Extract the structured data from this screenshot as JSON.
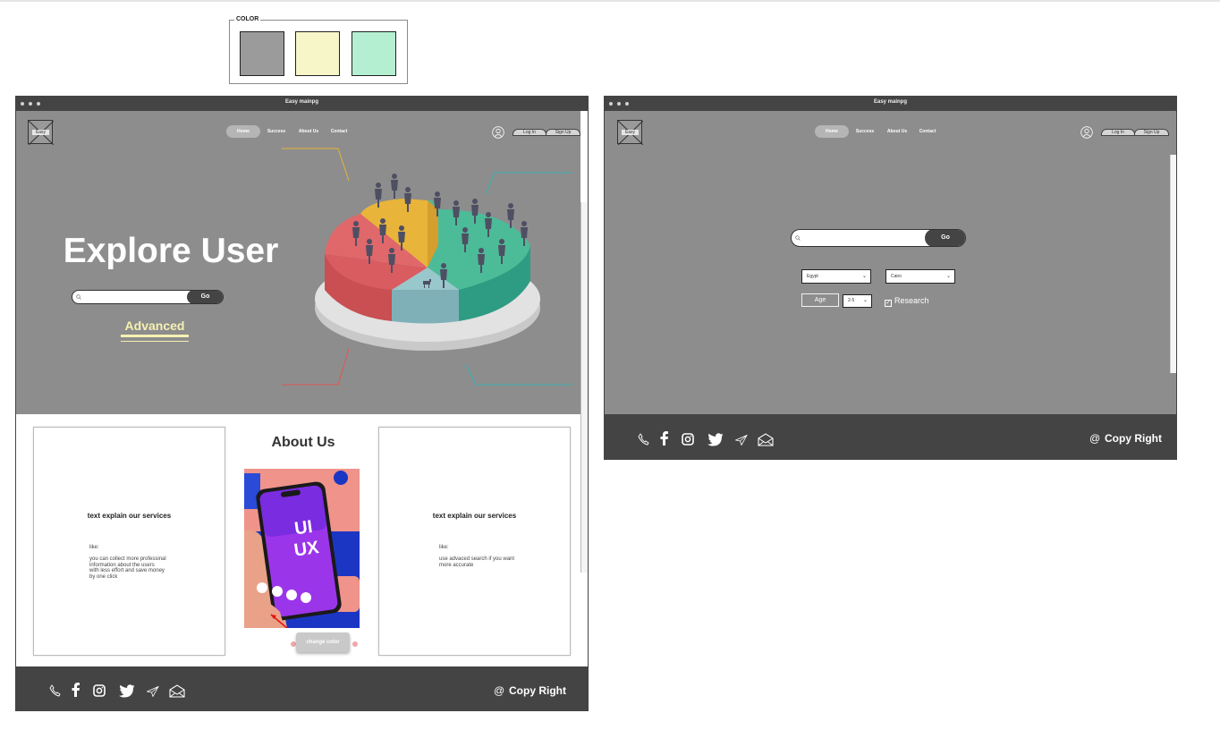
{
  "palette": {
    "legend": "COLOR",
    "swatches": [
      "#9b9b9b",
      "#f7f6c8",
      "#b4efd2"
    ]
  },
  "left_window": {
    "title": "Easy mainpg",
    "logo_text": "Easy",
    "nav": [
      "Home",
      "Success",
      "About Us",
      "Contact"
    ],
    "auth": {
      "login": "Log In",
      "signup": "Sign Up"
    },
    "hero_title": "Explore User",
    "search": {
      "placeholder": "",
      "go": "Go"
    },
    "advanced": "Advanced",
    "about_title": "About Us",
    "phone_text": [
      "UI",
      "UX"
    ],
    "change_color": "change color",
    "card_left": {
      "title": "text explain our services",
      "like": "like:",
      "body": [
        "you can collect more professinal",
        "information about the users",
        "with less effort and save money",
        "by one click"
      ]
    },
    "card_right": {
      "title": "text explain our services",
      "like": "like:",
      "body": [
        "use advaced search if you want",
        "more accurate"
      ]
    },
    "footer": {
      "copyright": "Copy Right",
      "icons": [
        "phone-icon",
        "facebook-icon",
        "instagram-icon",
        "twitter-icon",
        "send-icon",
        "mail-icon"
      ]
    }
  },
  "right_window": {
    "title": "Easy mainpg",
    "logo_text": "Easy",
    "nav": [
      "Home",
      "Success",
      "About Us",
      "Contact"
    ],
    "auth": {
      "login": "Log In",
      "signup": "Sign Up"
    },
    "search": {
      "placeholder": "",
      "go": "Go"
    },
    "country": "Egypt",
    "city": "Cairo",
    "age_label": "Age",
    "age_value": "2-5",
    "research_label": "Research",
    "research_checked": true,
    "footer": {
      "copyright": "Copy Right"
    }
  },
  "colors": {
    "hero_bg": "#8d8d8d",
    "footer_bg": "#444444",
    "accent_yellow": "#f5f1b3"
  }
}
